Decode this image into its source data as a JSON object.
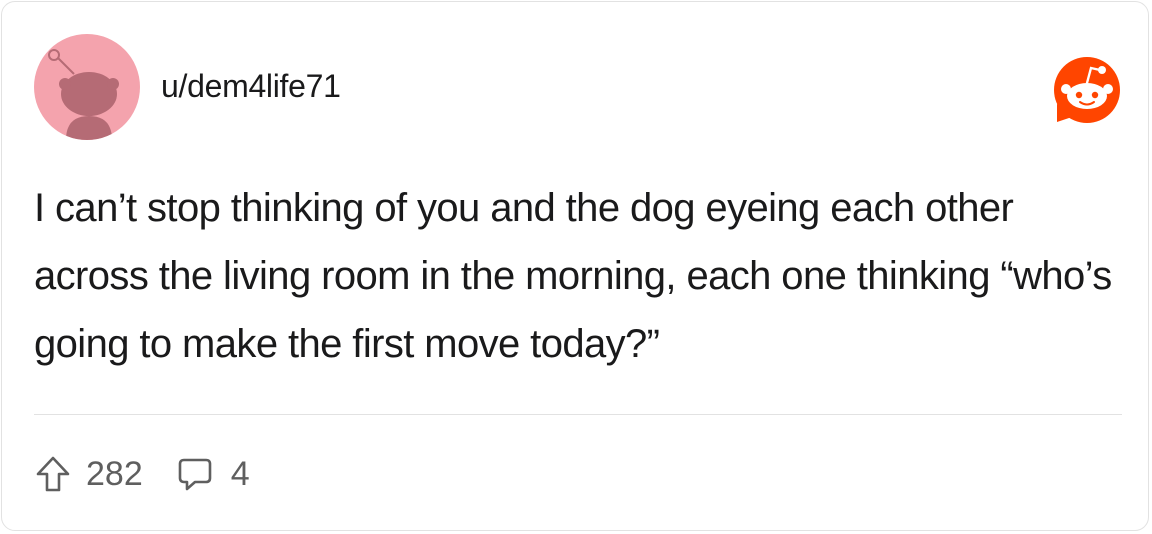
{
  "post": {
    "username": "u/dem4life71",
    "body": "I can’t stop thinking of you and the dog eyeing each other across the living room in the morning, each one thinking “who’s going to make the first move today?”"
  },
  "stats": {
    "upvotes": "282",
    "comments": "4"
  },
  "icons": {
    "avatar": "snoo-avatar-icon",
    "brand": "reddit-logo-icon",
    "upvote": "upvote-arrow-icon",
    "comment": "comment-bubble-icon"
  },
  "colors": {
    "avatar_bg": "#f4a3ad",
    "avatar_figure": "#b56b75",
    "brand_orange": "#ff4500",
    "text": "#1a1a1b",
    "muted": "#5f5f5f",
    "divider": "#e2e2e2"
  }
}
